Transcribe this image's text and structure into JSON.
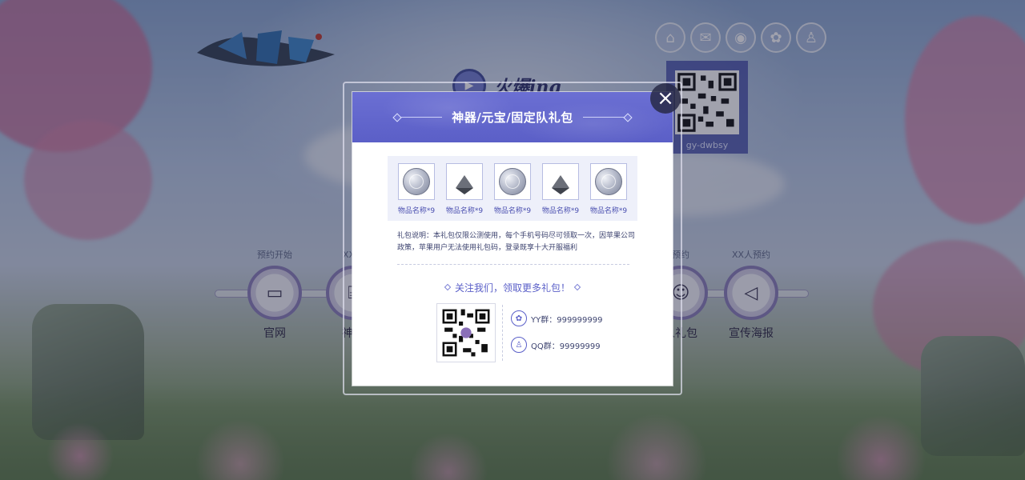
{
  "header": {
    "hot_label": "火爆ing",
    "qr_caption": "gy-dwbsy",
    "social": [
      {
        "icon": "home-icon",
        "glyph": "⌂"
      },
      {
        "icon": "wechat-icon",
        "glyph": "✉"
      },
      {
        "icon": "weibo-icon",
        "glyph": "◉"
      },
      {
        "icon": "yy-icon",
        "glyph": "✿"
      },
      {
        "icon": "qq-icon",
        "glyph": "♙"
      }
    ]
  },
  "milestones": [
    {
      "top": "预约开始",
      "label": "官网",
      "glyph": "▭"
    },
    {
      "top": "XX人",
      "label": "神器",
      "glyph": "⌸"
    },
    {
      "top": "预约",
      "label": "人礼包",
      "glyph": "☺"
    },
    {
      "top": "XX人预约",
      "label": "宣传海报",
      "glyph": "◁"
    }
  ],
  "modal": {
    "title": "神器/元宝/固定队礼包",
    "close_glyph": "×",
    "items": [
      {
        "type": "coin",
        "name": "物品名称*9"
      },
      {
        "type": "gem",
        "name": "物品名称*9"
      },
      {
        "type": "coin",
        "name": "物品名称*9"
      },
      {
        "type": "gem",
        "name": "物品名称*9"
      },
      {
        "type": "coin",
        "name": "物品名称*9"
      }
    ],
    "description": "礼包说明：本礼包仅限公测使用，每个手机号码尽可领取一次，因苹果公司政策，苹果用户无法使用礼包码，登录既享十大开服福利",
    "follow_text": "关注我们，领取更多礼包！",
    "contacts": [
      {
        "icon": "yy-icon",
        "glyph": "✿",
        "text": "YY群：999999999"
      },
      {
        "icon": "qq-icon",
        "glyph": "♙",
        "text": "QQ群：99999999"
      }
    ]
  },
  "colors": {
    "accent": "#5b5fc7",
    "overlay": "#1e223c",
    "text_primary": "#3e4470"
  }
}
